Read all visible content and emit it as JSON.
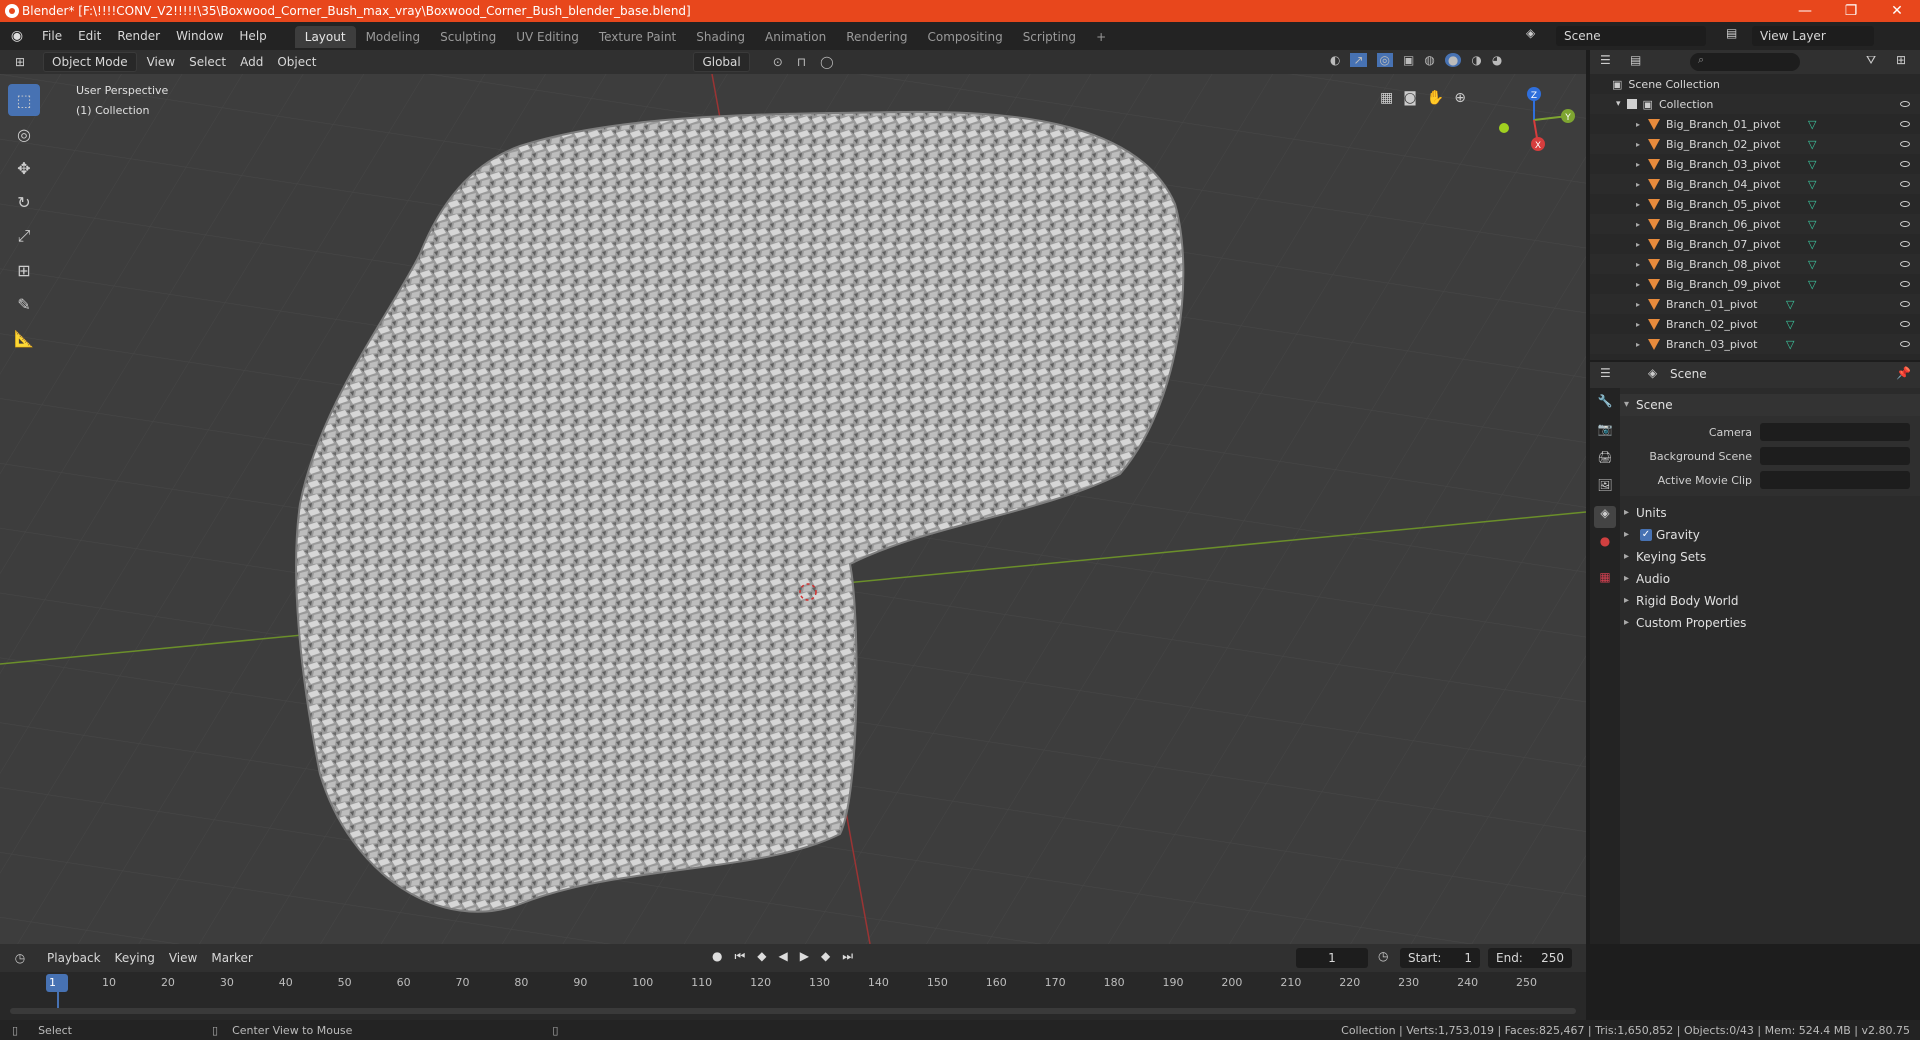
{
  "window": {
    "title": "Blender* [F:\\!!!!CONV_V2!!!!!\\35\\Boxwood_Corner_Bush_max_vray\\Boxwood_Corner_Bush_blender_base.blend]",
    "minimize": "—",
    "maximize": "❐",
    "close": "✕"
  },
  "menubar": {
    "items": [
      "File",
      "Edit",
      "Render",
      "Window",
      "Help"
    ],
    "workspaces": [
      "Layout",
      "Modeling",
      "Sculpting",
      "UV Editing",
      "Texture Paint",
      "Shading",
      "Animation",
      "Rendering",
      "Compositing",
      "Scripting"
    ],
    "add_workspace": "+",
    "scene": "Scene",
    "view_layer": "View Layer"
  },
  "viewport_header": {
    "mode": "Object Mode",
    "menus": [
      "View",
      "Select",
      "Add",
      "Object"
    ],
    "transform": "Global"
  },
  "viewport": {
    "perspective_label": "User Perspective",
    "collection_label": "(1) Collection",
    "gizmo": {
      "z": "Z",
      "y": "Y",
      "x": "X"
    }
  },
  "outliner": {
    "root": "Scene Collection",
    "collection": "Collection",
    "items": [
      "Big_Branch_01_pivot",
      "Big_Branch_02_pivot",
      "Big_Branch_03_pivot",
      "Big_Branch_04_pivot",
      "Big_Branch_05_pivot",
      "Big_Branch_06_pivot",
      "Big_Branch_07_pivot",
      "Big_Branch_08_pivot",
      "Big_Branch_09_pivot",
      "Branch_01_pivot",
      "Branch_02_pivot",
      "Branch_03_pivot"
    ]
  },
  "properties": {
    "header": "Scene",
    "scene_panel": "Scene",
    "fields": {
      "camera": "Camera",
      "background_scene": "Background Scene",
      "active_movie_clip": "Active Movie Clip"
    },
    "panels": [
      "Units",
      "Gravity",
      "Keying Sets",
      "Audio",
      "Rigid Body World",
      "Custom Properties"
    ]
  },
  "timeline": {
    "menus": [
      "Playback",
      "Keying",
      "View",
      "Marker"
    ],
    "current_frame": "1",
    "start_label": "Start:",
    "start": "1",
    "end_label": "End:",
    "end": "250",
    "ruler": [
      "1",
      "10",
      "20",
      "30",
      "40",
      "50",
      "60",
      "70",
      "80",
      "90",
      "100",
      "110",
      "120",
      "130",
      "140",
      "150",
      "160",
      "170",
      "180",
      "190",
      "200",
      "210",
      "220",
      "230",
      "240",
      "250"
    ]
  },
  "statusbar": {
    "left_action": "Select",
    "middle_action": "Center View to Mouse",
    "stats": "Collection | Verts:1,753,019 | Faces:825,467 | Tris:1,650,852 | Objects:0/43 | Mem: 524.4 MB | v2.80.75"
  }
}
